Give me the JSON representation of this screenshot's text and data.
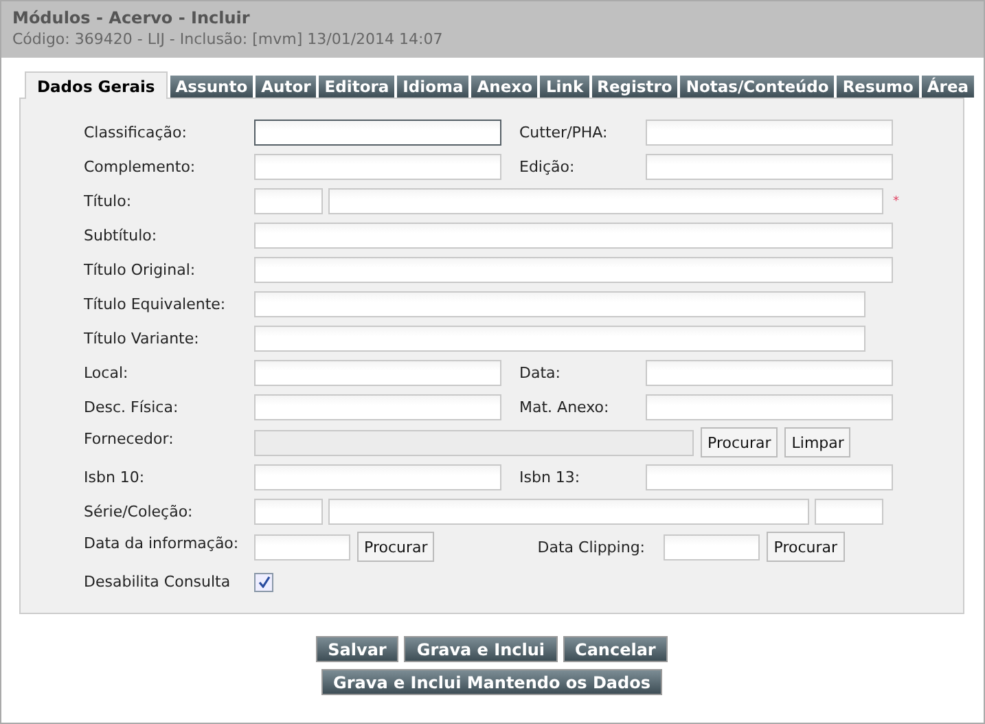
{
  "header": {
    "title": "Módulos - Acervo - Incluir",
    "subtitle": "Código: 369420 - LIJ - Inclusão: [mvm] 13/01/2014 14:07"
  },
  "tabs": [
    {
      "label": "Dados Gerais",
      "selected": true
    },
    {
      "label": "Assunto",
      "selected": false
    },
    {
      "label": "Autor",
      "selected": false
    },
    {
      "label": "Editora",
      "selected": false
    },
    {
      "label": "Idioma",
      "selected": false
    },
    {
      "label": "Anexo",
      "selected": false
    },
    {
      "label": "Link",
      "selected": false
    },
    {
      "label": "Registro",
      "selected": false
    },
    {
      "label": "Notas/Conteúdo",
      "selected": false
    },
    {
      "label": "Resumo",
      "selected": false
    },
    {
      "label": "Área",
      "selected": false
    }
  ],
  "rows": [
    {
      "kind": "pair",
      "label": "Classificação:",
      "focused": true,
      "label_2": "Cutter/PHA:"
    },
    {
      "kind": "pair",
      "label": "Complemento:",
      "focused": false,
      "label_2": "Edição:"
    },
    {
      "kind": "title",
      "label": "Título:",
      "focused": false,
      "required_mark": "*"
    },
    {
      "kind": "full",
      "label": "Subtítulo:",
      "focused": false
    },
    {
      "kind": "full",
      "label": "Título Original:",
      "focused": false
    },
    {
      "kind": "medium",
      "label": "Título Equivalente:",
      "focused": false
    },
    {
      "kind": "medium",
      "label": "Título Variante:",
      "focused": false
    },
    {
      "kind": "pair",
      "label": "Local:",
      "focused": false,
      "label_2": "Data:"
    },
    {
      "kind": "pair",
      "label": "Desc. Física:",
      "focused": false,
      "label_2": "Mat. Anexo:"
    },
    {
      "kind": "lookup",
      "label": "Fornecedor:",
      "disabled": true,
      "buttons": [
        "Procurar",
        "Limpar"
      ]
    },
    {
      "kind": "pair",
      "label": "Isbn 10:",
      "focused": false,
      "label_2": "Isbn 13:"
    },
    {
      "kind": "series",
      "label": "Série/Coleção:",
      "focused": false
    },
    {
      "kind": "dates",
      "label": "Data da informação:",
      "focused": false,
      "button": "Procurar",
      "label_2": "Data Clipping:",
      "button_2": "Procurar"
    },
    {
      "kind": "checkbox",
      "label": "Desabilita Consulta",
      "checked": true
    }
  ],
  "actions": [
    [
      "Salvar",
      "Grava e Inclui",
      "Cancelar"
    ],
    [
      "Grava e Inclui Mantendo os Dados"
    ]
  ]
}
